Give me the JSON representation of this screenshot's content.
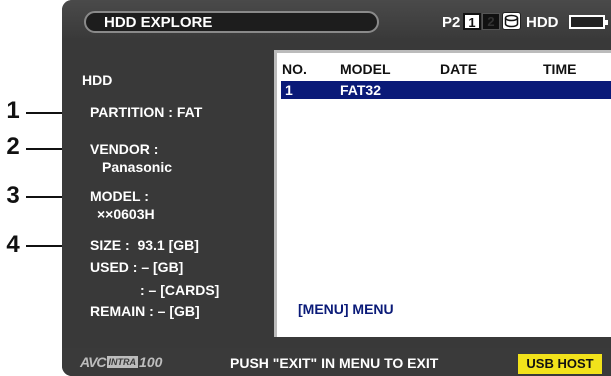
{
  "header": {
    "title": "HDD EXPLORE",
    "p2_label": "P2",
    "slot1": "1",
    "slot2": "2",
    "hdd_label": "HDD"
  },
  "callouts": [
    "1",
    "2",
    "3",
    "4"
  ],
  "info": {
    "hdd": "HDD",
    "partition": "PARTITION : FAT",
    "vendor_label": "VENDOR :",
    "vendor_value": "Panasonic",
    "model_label": "MODEL :",
    "model_value": "××0603H",
    "size": "SIZE :  93.1 [GB]",
    "used": "USED : – [GB]",
    "used_cards": ": – [CARDS]",
    "remain": "REMAIN : – [GB]"
  },
  "table": {
    "columns": [
      "NO.",
      "MODEL",
      "DATE",
      "TIME"
    ],
    "rows": [
      {
        "no": "1",
        "model": "FAT32",
        "date": "",
        "time": ""
      }
    ],
    "menu_hint": "[MENU] MENU"
  },
  "footer": {
    "avc_prefix": "AVC",
    "intra": "INTRA",
    "avc_suffix": "100",
    "exit_message": "PUSH \"EXIT\" IN MENU TO EXIT",
    "usb_host": "USB HOST"
  },
  "colors": {
    "screen_bg": "#393939",
    "selection": "#0a1a78",
    "usb_host_bg": "#f2e21b"
  }
}
